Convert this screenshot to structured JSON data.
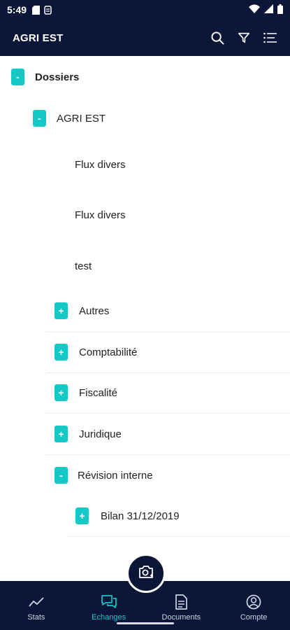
{
  "status_bar": {
    "time": "5:49"
  },
  "app_bar": {
    "title": "AGRI EST"
  },
  "tree": {
    "root": {
      "label": "Dossiers",
      "toggle": "-"
    },
    "client": {
      "label": "AGRI EST",
      "toggle": "-"
    },
    "files": [
      "Flux divers",
      "Flux divers",
      "test"
    ],
    "folders": [
      {
        "label": "Autres",
        "toggle": "+"
      },
      {
        "label": "Comptabilité",
        "toggle": "+"
      },
      {
        "label": "Fiscalité",
        "toggle": "+"
      },
      {
        "label": "Juridique",
        "toggle": "+"
      },
      {
        "label": "Révision interne",
        "toggle": "-"
      }
    ],
    "subfolder": {
      "label": "Bilan 31/12/2019",
      "toggle": "+"
    }
  },
  "bottom_nav": {
    "items": [
      {
        "label": "Stats",
        "icon": "stats-icon",
        "active": false
      },
      {
        "label": "Echanges",
        "icon": "chat-icon",
        "active": true
      },
      {
        "label": "Documents",
        "icon": "document-icon",
        "active": false
      },
      {
        "label": "Compte",
        "icon": "account-icon",
        "active": false
      }
    ]
  },
  "colors": {
    "primary": "#0b1638",
    "accent": "#14c8c8"
  }
}
